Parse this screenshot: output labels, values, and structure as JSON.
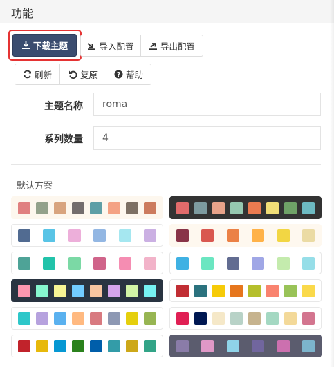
{
  "header": {
    "title": "功能"
  },
  "toolbar": {
    "download_label": "下载主题",
    "import_label": "导入配置",
    "export_label": "导出配置",
    "refresh_label": "刷新",
    "restore_label": "复原",
    "help_label": "帮助"
  },
  "form": {
    "theme_name_label": "主题名称",
    "theme_name_value": "roma",
    "series_count_label": "系列数量",
    "series_count_value": "4"
  },
  "schemes_title": "默认方案",
  "schemes": [
    {
      "background": "#fdf7ee",
      "colors": [
        "#e08080",
        "#93a18b",
        "#d8a47f",
        "#736d6d",
        "#5e9fa6",
        "#f4a284",
        "#7d7064",
        "#cc7b5e"
      ]
    },
    {
      "background": "#333333",
      "colors": [
        "#e16b6b",
        "#7d9ba0",
        "#e8a38a",
        "#95c8b0",
        "#eb7b50",
        "#f1de77",
        "#6fa267",
        "#6dbac2"
      ]
    },
    {
      "background": "#ffffff",
      "colors": [
        "#516b91",
        "#59c4e6",
        "#edafda",
        "#93b7e3",
        "#a5e7f0",
        "#cbb0e3"
      ]
    },
    {
      "background": "#fef8ef",
      "colors": [
        "#893448",
        "#d95850",
        "#eb8146",
        "#ffb248",
        "#f2d643",
        "#ebdba4"
      ]
    },
    {
      "background": "#ffffff",
      "colors": [
        "#4ea397",
        "#22c3aa",
        "#7bd9a5",
        "#d0648a",
        "#f58db2",
        "#f2b3c9"
      ]
    },
    {
      "background": "#ffffff",
      "colors": [
        "#3fb1e3",
        "#6be6c1",
        "#626c91",
        "#a0a7e6",
        "#c4ebad",
        "#96dee8"
      ]
    },
    {
      "background": "#293441",
      "colors": [
        "#fc97af",
        "#87f7cf",
        "#f7f494",
        "#72ccff",
        "#f7c5a0",
        "#d4a4eb",
        "#d2f5a6",
        "#76f2f2"
      ]
    },
    {
      "background": "#ffffff",
      "colors": [
        "#c12e34",
        "#2b727e",
        "#f6cb08",
        "#e6761d",
        "#b5bf2c",
        "#f9836f",
        "#99c358",
        "#fad94a"
      ]
    },
    {
      "background": "#ffffff",
      "colors": [
        "#2ec7c9",
        "#b6a2de",
        "#5ab1ef",
        "#ffb980",
        "#d87a80",
        "#8d98b3",
        "#e5cf0d",
        "#97b552"
      ]
    },
    {
      "background": "#ffffff",
      "colors": [
        "#e01f54",
        "#001852",
        "#f5e8c8",
        "#b8d2c7",
        "#c6b38e",
        "#a4d8c2",
        "#f3d999",
        "#d3758f"
      ]
    },
    {
      "background": "#ffffff",
      "colors": [
        "#c1232b",
        "#e7b90b",
        "#0698d3",
        "#2b821d",
        "#005eaa",
        "#339ca8",
        "#cda819",
        "#32a487"
      ]
    },
    {
      "background": "#5b5c6e",
      "colors": [
        "#8a7ca8",
        "#e098c7",
        "#8fd3e8",
        "#71669e",
        "#cc70af",
        "#7cb4cc"
      ]
    }
  ]
}
